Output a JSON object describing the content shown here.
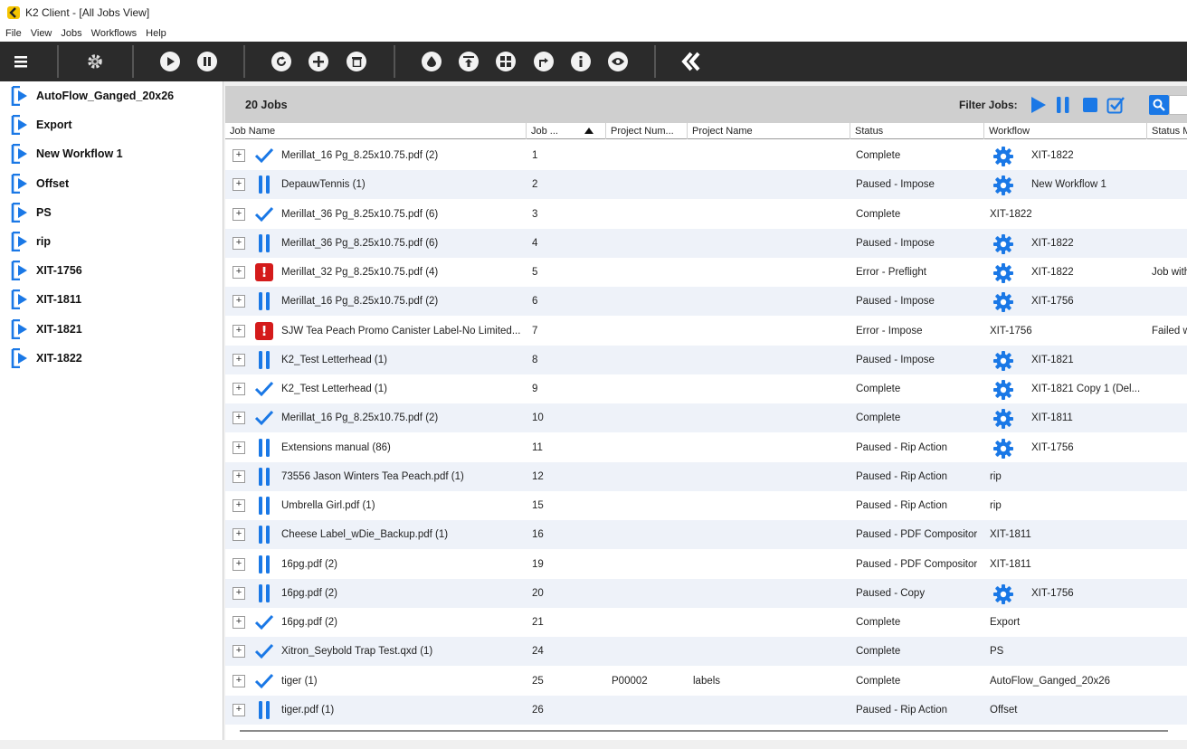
{
  "window": {
    "title": "K2 Client - [All Jobs View]"
  },
  "menu": [
    "File",
    "View",
    "Jobs",
    "Workflows",
    "Help"
  ],
  "toolbar": {
    "icons": [
      "menu-icon",
      "settings-gear-icon",
      "play-icon",
      "pause-icon",
      "refresh-icon",
      "add-icon",
      "delete-icon",
      "ink-drop-icon",
      "align-top-icon",
      "grid-icon",
      "redirect-icon",
      "info-icon",
      "preview-eye-icon",
      "k2-logo-icon"
    ]
  },
  "sidebar": {
    "items": [
      "AutoFlow_Ganged_20x26",
      "Export",
      "New Workflow 1",
      "Offset",
      "PS",
      "rip",
      "XIT-1756",
      "XIT-1811",
      "XIT-1821",
      "XIT-1822"
    ]
  },
  "jobs_header": {
    "count": "20 Jobs",
    "filter_label": "Filter Jobs:"
  },
  "columns": [
    "Job Name",
    "Job ...",
    "Project Num...",
    "Project Name",
    "Status",
    "Workflow",
    "Status M"
  ],
  "colors": {
    "accent": "#1a78e6",
    "error": "#d41b1b",
    "toolbar": "#2b2b2b"
  },
  "jobs": [
    {
      "icon": "check",
      "name": "Merillat_16 Pg_8.25x10.75.pdf (2)",
      "job": "1",
      "proj_num": "",
      "proj_name": "",
      "status": "Complete",
      "gear": true,
      "workflow": "XIT-1822",
      "msg": ""
    },
    {
      "icon": "pause",
      "name": "DepauwTennis (1)",
      "job": "2",
      "proj_num": "",
      "proj_name": "",
      "status": "Paused - Impose",
      "gear": true,
      "workflow": "New Workflow 1",
      "msg": ""
    },
    {
      "icon": "check",
      "name": "Merillat_36 Pg_8.25x10.75.pdf (6)",
      "job": "3",
      "proj_num": "",
      "proj_name": "",
      "status": "Complete",
      "gear": false,
      "workflow": "XIT-1822",
      "msg": ""
    },
    {
      "icon": "pause",
      "name": "Merillat_36 Pg_8.25x10.75.pdf (6)",
      "job": "4",
      "proj_num": "",
      "proj_name": "",
      "status": "Paused - Impose",
      "gear": true,
      "workflow": "XIT-1822",
      "msg": ""
    },
    {
      "icon": "error",
      "name": "Merillat_32 Pg_8.25x10.75.pdf (4)",
      "job": "5",
      "proj_num": "",
      "proj_name": "",
      "status": "Error - Preflight",
      "gear": true,
      "workflow": "XIT-1822",
      "msg": "Job with"
    },
    {
      "icon": "pause",
      "name": "Merillat_16 Pg_8.25x10.75.pdf (2)",
      "job": "6",
      "proj_num": "",
      "proj_name": "",
      "status": "Paused - Impose",
      "gear": true,
      "workflow": "XIT-1756",
      "msg": ""
    },
    {
      "icon": "error",
      "name": "SJW Tea Peach Promo Canister Label-No Limited...",
      "job": "7",
      "proj_num": "",
      "proj_name": "",
      "status": "Error - Impose",
      "gear": false,
      "workflow": "XIT-1756",
      "msg": "Failed w"
    },
    {
      "icon": "pause",
      "name": "K2_Test Letterhead (1)",
      "job": "8",
      "proj_num": "",
      "proj_name": "",
      "status": "Paused - Impose",
      "gear": true,
      "workflow": "XIT-1821",
      "msg": ""
    },
    {
      "icon": "check",
      "name": "K2_Test Letterhead (1)",
      "job": "9",
      "proj_num": "",
      "proj_name": "",
      "status": "Complete",
      "gear": true,
      "workflow": "XIT-1821 Copy 1 (Del...",
      "msg": ""
    },
    {
      "icon": "check",
      "name": "Merillat_16 Pg_8.25x10.75.pdf (2)",
      "job": "10",
      "proj_num": "",
      "proj_name": "",
      "status": "Complete",
      "gear": true,
      "workflow": "XIT-1811",
      "msg": ""
    },
    {
      "icon": "pause",
      "name": "Extensions manual (86)",
      "job": "11",
      "proj_num": "",
      "proj_name": "",
      "status": "Paused - Rip Action",
      "gear": true,
      "workflow": "XIT-1756",
      "msg": ""
    },
    {
      "icon": "pause",
      "name": "73556 Jason Winters Tea Peach.pdf (1)",
      "job": "12",
      "proj_num": "",
      "proj_name": "",
      "status": "Paused - Rip Action",
      "gear": false,
      "workflow": "rip",
      "msg": ""
    },
    {
      "icon": "pause",
      "name": "Umbrella Girl.pdf (1)",
      "job": "15",
      "proj_num": "",
      "proj_name": "",
      "status": "Paused - Rip Action",
      "gear": false,
      "workflow": "rip",
      "msg": ""
    },
    {
      "icon": "pause",
      "name": "Cheese Label_wDie_Backup.pdf (1)",
      "job": "16",
      "proj_num": "",
      "proj_name": "",
      "status": "Paused - PDF Compositor",
      "gear": false,
      "workflow": "XIT-1811",
      "msg": ""
    },
    {
      "icon": "pause",
      "name": "16pg.pdf (2)",
      "job": "19",
      "proj_num": "",
      "proj_name": "",
      "status": "Paused - PDF Compositor",
      "gear": false,
      "workflow": "XIT-1811",
      "msg": ""
    },
    {
      "icon": "pause",
      "name": "16pg.pdf (2)",
      "job": "20",
      "proj_num": "",
      "proj_name": "",
      "status": "Paused - Copy",
      "gear": true,
      "workflow": "XIT-1756",
      "msg": ""
    },
    {
      "icon": "check",
      "name": "16pg.pdf (2)",
      "job": "21",
      "proj_num": "",
      "proj_name": "",
      "status": "Complete",
      "gear": false,
      "workflow": "Export",
      "msg": ""
    },
    {
      "icon": "check",
      "name": "Xitron_Seybold Trap Test.qxd (1)",
      "job": "24",
      "proj_num": "",
      "proj_name": "",
      "status": "Complete",
      "gear": false,
      "workflow": "PS",
      "msg": ""
    },
    {
      "icon": "check",
      "name": "tiger (1)",
      "job": "25",
      "proj_num": "P00002",
      "proj_name": "labels",
      "status": "Complete",
      "gear": false,
      "workflow": "AutoFlow_Ganged_20x26",
      "msg": ""
    },
    {
      "icon": "pause",
      "name": "tiger.pdf (1)",
      "job": "26",
      "proj_num": "",
      "proj_name": "",
      "status": "Paused - Rip Action",
      "gear": false,
      "workflow": "Offset",
      "msg": ""
    }
  ]
}
